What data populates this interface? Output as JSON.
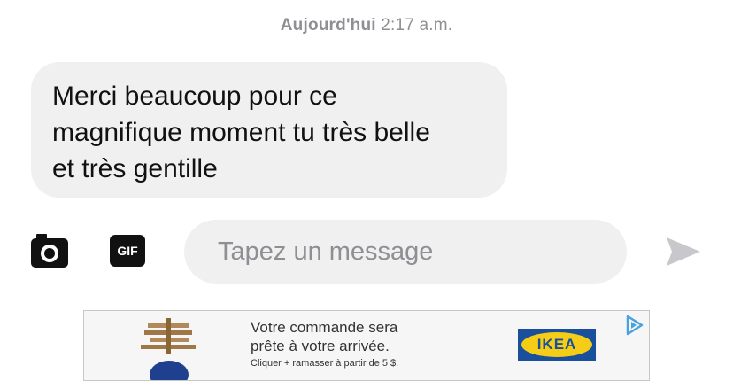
{
  "header": {
    "day": "Aujourd'hui",
    "time": "2:17 a.m."
  },
  "message": {
    "lines": [
      "Merci beaucoup pour ce",
      "magnifique moment tu très belle",
      "et très gentille"
    ]
  },
  "composer": {
    "camera_icon": "camera-icon",
    "gif_label": "GIF",
    "placeholder": "Tapez un message",
    "value": "",
    "send_icon": "send-arrow-icon"
  },
  "ad": {
    "line1": "Votre commande sera",
    "line2": "prête à votre arrivée.",
    "sub": "Cliquer + ramasser à partir de 5 $.",
    "brand": "IKEA",
    "adchoices_icon": "adchoices-icon",
    "brand_color": "#1a4f9c",
    "brand_accent": "#f5cc16"
  },
  "colors": {
    "bubble": "#f0f0f0",
    "muted_text": "#8e8e93",
    "send_icon": "#c7c7cc"
  }
}
